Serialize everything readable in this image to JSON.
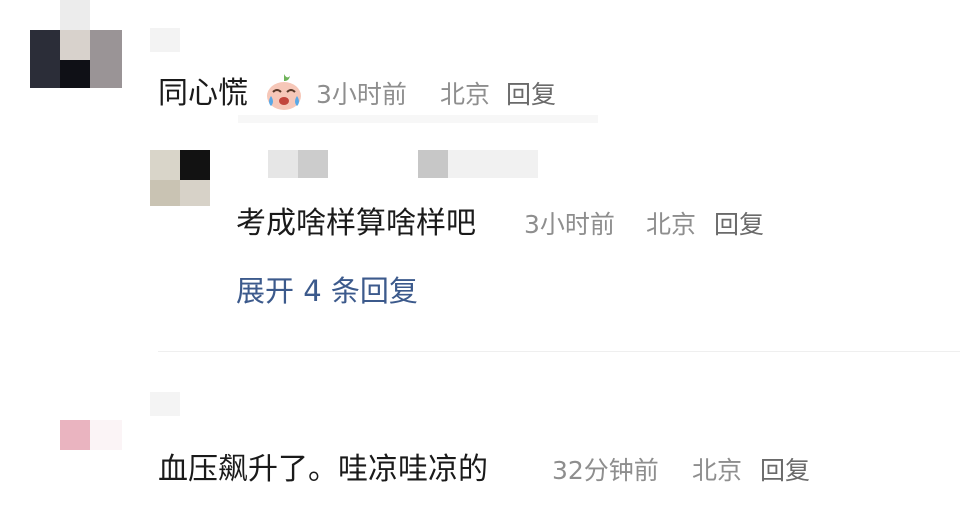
{
  "comments": [
    {
      "text": "同心慌",
      "emoji": "crying-laughing-emoji-icon",
      "time": "3小时前",
      "location": "北京",
      "reply_label": "回复"
    },
    {
      "text": "血压飙升了。哇凉哇凉的",
      "time": "32分钟前",
      "location": "北京",
      "reply_label": "回复"
    }
  ],
  "reply": {
    "text": "考成啥样算啥样吧",
    "time": "3小时前",
    "location": "北京",
    "reply_label": "回复"
  },
  "expand_label": "展开 4 条回复",
  "colors": {
    "text": "#1a1a1a",
    "meta": "#8e8e8e",
    "link": "#3c5a8c",
    "divider": "#efefef"
  }
}
